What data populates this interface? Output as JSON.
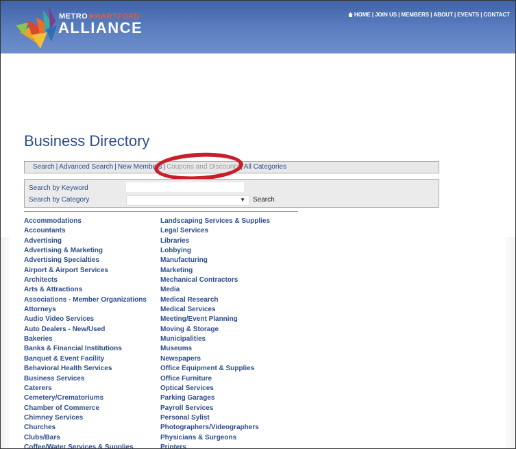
{
  "header": {
    "brand": {
      "metro": "METRO",
      "star": "★",
      "hartford": "HARTFORD",
      "alliance": "ALLIANCE"
    },
    "nav": [
      "HOME",
      "JOIN US",
      "MEMBERS",
      "ABOUT",
      "EVENTS",
      "CONTACT"
    ],
    "nav_separator": "|",
    "bg_color": "#4a6fb3"
  },
  "page_title": "Business Directory",
  "tabs": {
    "items": [
      "Search",
      "Advanced Search",
      "New Members",
      "Coupons and Discounts",
      "All Categories"
    ],
    "active_index": 3,
    "separator": "|"
  },
  "search": {
    "keyword_label": "Search by Keyword",
    "category_label": "Search by Category",
    "keyword_value": "",
    "category_value": "",
    "button_label": "Search",
    "arrow": "▼"
  },
  "categories": {
    "column1": [
      "Accommodations",
      "Accountants",
      "Advertising",
      "Advertising & Marketing",
      "Advertising Specialties",
      "Airport & Airport Services",
      "Architects",
      "Arts & Attractions",
      "Associations - Member Organizations",
      "Attorneys",
      "Audio Video Services",
      "Auto Dealers - New/Used",
      "Bakeries",
      "Banks & Financial Institutions",
      "Banquet & Event Facility",
      "Behavioral Health Services",
      "Business Services",
      "Caterers",
      "Cemetery/Crematoriums",
      "Chamber of Commerce",
      "Chimney Services",
      "Churches",
      "Clubs/Bars",
      "Coffee/Water Services & Supplies"
    ],
    "column2": [
      "Landscaping Services & Supplies",
      "Legal Services",
      "Libraries",
      "Lobbying",
      "Manufacturing",
      "Marketing",
      "Mechanical Contractors",
      "Media",
      "Medical Research",
      "Medical Services",
      "Meeting/Event Planning",
      "Moving & Storage",
      "Municipalities",
      "Museums",
      "Newspapers",
      "Office Equipment & Supplies",
      "Office Furniture",
      "Optical Services",
      "Parking Garages",
      "Payroll Services",
      "Personal Sylist",
      "Photographers/Videographers",
      "Physicians & Surgeons",
      "Printers"
    ]
  },
  "colors": {
    "link": "#2b4c8a",
    "highlight_circle": "#c8202b"
  }
}
